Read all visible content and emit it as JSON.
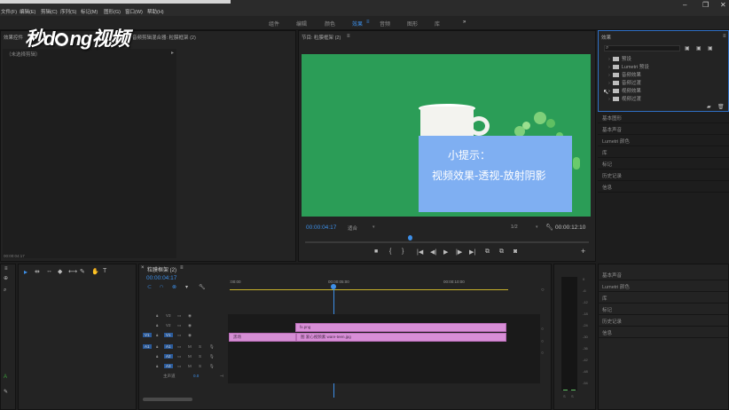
{
  "menu": {
    "items": [
      "文件(F)",
      "编辑(E)",
      "剪辑(C)",
      "序列(S)",
      "标记(M)",
      "图形(G)",
      "窗口(W)",
      "帮助(H)"
    ],
    "window_controls": [
      "–",
      "❐",
      "✕"
    ]
  },
  "workspace": {
    "tabs": [
      "组件",
      "编辑",
      "颜色",
      "效果",
      "音频",
      "图形",
      "库"
    ],
    "active": "效果",
    "more": "»"
  },
  "logo": {
    "text_left": "秒",
    "text_mid": "ng",
    "text_right": "视频",
    "letter_d": "d"
  },
  "effect_controls": {
    "title": "效果控件",
    "title_extra": "音频剪辑混合器: 粒膜框架 (2)",
    "no_clip": "（未选择剪辑）",
    "timecode": "00:00:04:17"
  },
  "program_monitor": {
    "title": "节目: 粒膜框架 (2)",
    "hint_title": "小提示：",
    "hint_text": "视频效果-透视-放射阴影",
    "timecode_current": "00:00:04:17",
    "fit": "适合",
    "quality": "1/2",
    "timecode_duration": "00:00:12:10",
    "playhead_fraction": 0.37,
    "transport": [
      "■",
      "{",
      "}",
      "|◀",
      "◀|",
      "▶",
      "|▶",
      "▶|",
      "⧉",
      "⧉",
      "◙",
      "+"
    ]
  },
  "effects_panel": {
    "title": "效果",
    "search_placeholder": "",
    "folders": [
      "预设",
      "Lumetri 预设",
      "音频效果",
      "音频过渡",
      "视频效果",
      "视频过渡"
    ],
    "collapsed": [
      "基本图形",
      "基本声音",
      "Lumetri 颜色",
      "库",
      "标记",
      "历史记录",
      "信息"
    ]
  },
  "lower_right": {
    "items": [
      "基本声音",
      "Lumetri 颜色",
      "库",
      "标记",
      "历史记录",
      "信息"
    ]
  },
  "timeline": {
    "title": "粒膜框架 (2)",
    "timecode": "00:00:04:17",
    "ruler": [
      ":00:00",
      "00:00:05:00",
      "00:00:10:00"
    ],
    "tracks": [
      {
        "name": "V3",
        "type": "video"
      },
      {
        "name": "V2",
        "type": "video"
      },
      {
        "name": "V1",
        "type": "video",
        "source": "V1"
      },
      {
        "name": "A1",
        "type": "audio",
        "source": "A1"
      },
      {
        "name": "A2",
        "type": "audio"
      },
      {
        "name": "A3",
        "type": "audio"
      }
    ],
    "master": "主声道",
    "master_value": "0.0",
    "clips": [
      {
        "label": "fx.png"
      },
      {
        "label": "黑场"
      },
      {
        "label": "图 爱心视频素 ware-teen.jpg"
      }
    ],
    "track_buttons": [
      "M",
      "S"
    ]
  },
  "tools": {
    "items": [
      "▸",
      "⇹",
      "↔",
      "◆",
      "⟷",
      "✎",
      "✋",
      "T"
    ]
  },
  "meters": {
    "ticks": [
      "0",
      "-6",
      "-12",
      "-18",
      "-24",
      "-30",
      "-36",
      "-42",
      "-48",
      "-54"
    ],
    "bottom": [
      "S",
      "S"
    ]
  }
}
